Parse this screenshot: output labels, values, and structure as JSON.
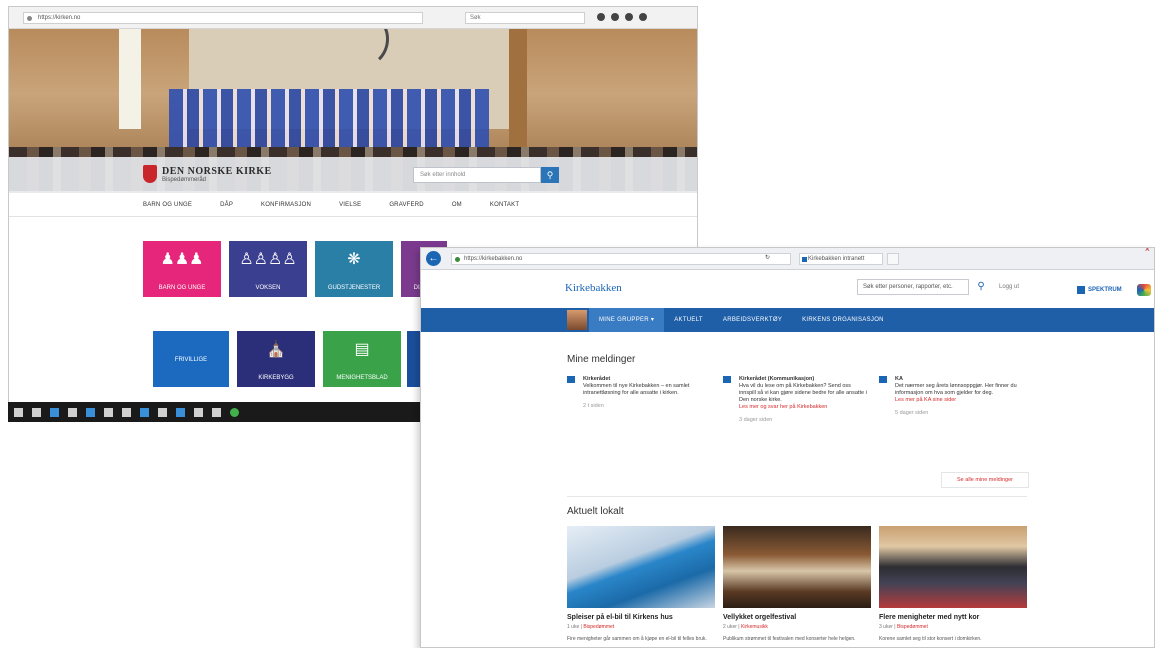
{
  "window1": {
    "address": "https://kirken.no",
    "search_placeholder": "Søk",
    "logo_name": "DEN NORSKE KIRKE",
    "logo_sub": "Bispedømmeråd",
    "site_search_placeholder": "Søk etter innhold",
    "nav": [
      "Barn og unge",
      "Dåp",
      "Konfirmasjon",
      "Vielse",
      "Gravferd",
      "Om",
      "Kontakt"
    ],
    "tiles": [
      {
        "label": "Barn og unge",
        "color": "#e6267a"
      },
      {
        "label": "Voksen",
        "color": "#3b3f8f"
      },
      {
        "label": "Gudstjenester",
        "color": "#2a7fa6"
      },
      {
        "label": "Dia og",
        "color": "#7b3a8e"
      },
      {
        "label": "Frivillige",
        "color": "#1b6ac0"
      },
      {
        "label": "Kirkebygg",
        "color": "#2b2f7a"
      },
      {
        "label": "Menighetsblad",
        "color": "#3aa34a"
      },
      {
        "label": "",
        "color": "#1b4f9c"
      }
    ]
  },
  "window2": {
    "address": "https://kirkebakken.no",
    "tab_title": "Kirkebakken intranett",
    "brand": "Kirkebakken",
    "search_placeholder": "Søk etter personer, rapporter, etc.",
    "login": "Logg ut",
    "partner": "SPEKTRUM",
    "nav": [
      "Mine grupper",
      "Aktuelt",
      "Arbeidsverktøy",
      "Kirkens organisasjon"
    ],
    "messages_title": "Mine meldinger",
    "messages": [
      {
        "from": "Kirkerådet",
        "text": "Velkommen til nye Kirkebakken – en samlet intranettløsning for alle ansatte i kirken.",
        "link": "",
        "time": "2 t siden"
      },
      {
        "from": "Kirkerådet (Kommunikasjon)",
        "text": "Hva vil du lese om på Kirkebakken? Send oss innspill så vi kan gjøre sidene bedre for alle ansatte i Den norske kirke.",
        "link": "Les mer og svar her på Kirkebakken",
        "time": "3 dager siden"
      },
      {
        "from": "KA",
        "text": "Det nærmer seg årets lønnsoppgjør. Her finner du informasjon om hva som gjelder for deg.",
        "link": "Les mer på KA sine sider",
        "time": "5 dager siden"
      }
    ],
    "all_messages": "Se alle mine meldinger",
    "news_title": "Aktuelt lokalt",
    "news": [
      {
        "headline": "Spleiser på el-bil til Kirkens hus",
        "meta": "1 uke",
        "tag": "Bispedømmet",
        "teaser": "Fire menigheter går sammen om å kjøpe en el-bil til felles bruk."
      },
      {
        "headline": "Vellykket orgelfestival",
        "meta": "2 uker",
        "tag": "Kirkemusikk",
        "teaser": "Publikum strømmet til festivalen med konserter hele helgen."
      },
      {
        "headline": "Flere menigheter med nytt kor",
        "meta": "3 uker",
        "tag": "Bispedømmet",
        "teaser": "Korene samlet seg til stor konsert i domkirken."
      }
    ]
  }
}
